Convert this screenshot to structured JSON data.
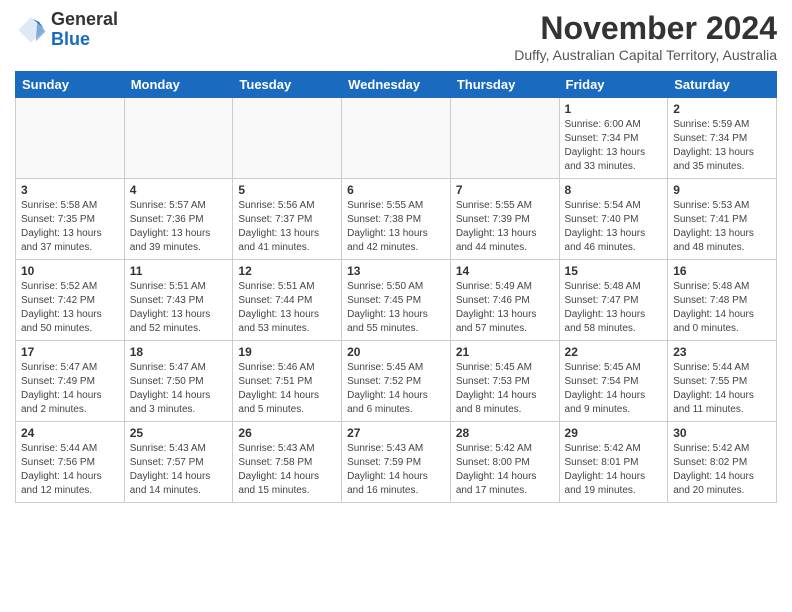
{
  "header": {
    "logo_line1": "General",
    "logo_line2": "Blue",
    "month_year": "November 2024",
    "location": "Duffy, Australian Capital Territory, Australia"
  },
  "days_of_week": [
    "Sunday",
    "Monday",
    "Tuesday",
    "Wednesday",
    "Thursday",
    "Friday",
    "Saturday"
  ],
  "weeks": [
    [
      {
        "day": "",
        "info": ""
      },
      {
        "day": "",
        "info": ""
      },
      {
        "day": "",
        "info": ""
      },
      {
        "day": "",
        "info": ""
      },
      {
        "day": "",
        "info": ""
      },
      {
        "day": "1",
        "info": "Sunrise: 6:00 AM\nSunset: 7:34 PM\nDaylight: 13 hours\nand 33 minutes."
      },
      {
        "day": "2",
        "info": "Sunrise: 5:59 AM\nSunset: 7:34 PM\nDaylight: 13 hours\nand 35 minutes."
      }
    ],
    [
      {
        "day": "3",
        "info": "Sunrise: 5:58 AM\nSunset: 7:35 PM\nDaylight: 13 hours\nand 37 minutes."
      },
      {
        "day": "4",
        "info": "Sunrise: 5:57 AM\nSunset: 7:36 PM\nDaylight: 13 hours\nand 39 minutes."
      },
      {
        "day": "5",
        "info": "Sunrise: 5:56 AM\nSunset: 7:37 PM\nDaylight: 13 hours\nand 41 minutes."
      },
      {
        "day": "6",
        "info": "Sunrise: 5:55 AM\nSunset: 7:38 PM\nDaylight: 13 hours\nand 42 minutes."
      },
      {
        "day": "7",
        "info": "Sunrise: 5:55 AM\nSunset: 7:39 PM\nDaylight: 13 hours\nand 44 minutes."
      },
      {
        "day": "8",
        "info": "Sunrise: 5:54 AM\nSunset: 7:40 PM\nDaylight: 13 hours\nand 46 minutes."
      },
      {
        "day": "9",
        "info": "Sunrise: 5:53 AM\nSunset: 7:41 PM\nDaylight: 13 hours\nand 48 minutes."
      }
    ],
    [
      {
        "day": "10",
        "info": "Sunrise: 5:52 AM\nSunset: 7:42 PM\nDaylight: 13 hours\nand 50 minutes."
      },
      {
        "day": "11",
        "info": "Sunrise: 5:51 AM\nSunset: 7:43 PM\nDaylight: 13 hours\nand 52 minutes."
      },
      {
        "day": "12",
        "info": "Sunrise: 5:51 AM\nSunset: 7:44 PM\nDaylight: 13 hours\nand 53 minutes."
      },
      {
        "day": "13",
        "info": "Sunrise: 5:50 AM\nSunset: 7:45 PM\nDaylight: 13 hours\nand 55 minutes."
      },
      {
        "day": "14",
        "info": "Sunrise: 5:49 AM\nSunset: 7:46 PM\nDaylight: 13 hours\nand 57 minutes."
      },
      {
        "day": "15",
        "info": "Sunrise: 5:48 AM\nSunset: 7:47 PM\nDaylight: 13 hours\nand 58 minutes."
      },
      {
        "day": "16",
        "info": "Sunrise: 5:48 AM\nSunset: 7:48 PM\nDaylight: 14 hours\nand 0 minutes."
      }
    ],
    [
      {
        "day": "17",
        "info": "Sunrise: 5:47 AM\nSunset: 7:49 PM\nDaylight: 14 hours\nand 2 minutes."
      },
      {
        "day": "18",
        "info": "Sunrise: 5:47 AM\nSunset: 7:50 PM\nDaylight: 14 hours\nand 3 minutes."
      },
      {
        "day": "19",
        "info": "Sunrise: 5:46 AM\nSunset: 7:51 PM\nDaylight: 14 hours\nand 5 minutes."
      },
      {
        "day": "20",
        "info": "Sunrise: 5:45 AM\nSunset: 7:52 PM\nDaylight: 14 hours\nand 6 minutes."
      },
      {
        "day": "21",
        "info": "Sunrise: 5:45 AM\nSunset: 7:53 PM\nDaylight: 14 hours\nand 8 minutes."
      },
      {
        "day": "22",
        "info": "Sunrise: 5:45 AM\nSunset: 7:54 PM\nDaylight: 14 hours\nand 9 minutes."
      },
      {
        "day": "23",
        "info": "Sunrise: 5:44 AM\nSunset: 7:55 PM\nDaylight: 14 hours\nand 11 minutes."
      }
    ],
    [
      {
        "day": "24",
        "info": "Sunrise: 5:44 AM\nSunset: 7:56 PM\nDaylight: 14 hours\nand 12 minutes."
      },
      {
        "day": "25",
        "info": "Sunrise: 5:43 AM\nSunset: 7:57 PM\nDaylight: 14 hours\nand 14 minutes."
      },
      {
        "day": "26",
        "info": "Sunrise: 5:43 AM\nSunset: 7:58 PM\nDaylight: 14 hours\nand 15 minutes."
      },
      {
        "day": "27",
        "info": "Sunrise: 5:43 AM\nSunset: 7:59 PM\nDaylight: 14 hours\nand 16 minutes."
      },
      {
        "day": "28",
        "info": "Sunrise: 5:42 AM\nSunset: 8:00 PM\nDaylight: 14 hours\nand 17 minutes."
      },
      {
        "day": "29",
        "info": "Sunrise: 5:42 AM\nSunset: 8:01 PM\nDaylight: 14 hours\nand 19 minutes."
      },
      {
        "day": "30",
        "info": "Sunrise: 5:42 AM\nSunset: 8:02 PM\nDaylight: 14 hours\nand 20 minutes."
      }
    ]
  ]
}
